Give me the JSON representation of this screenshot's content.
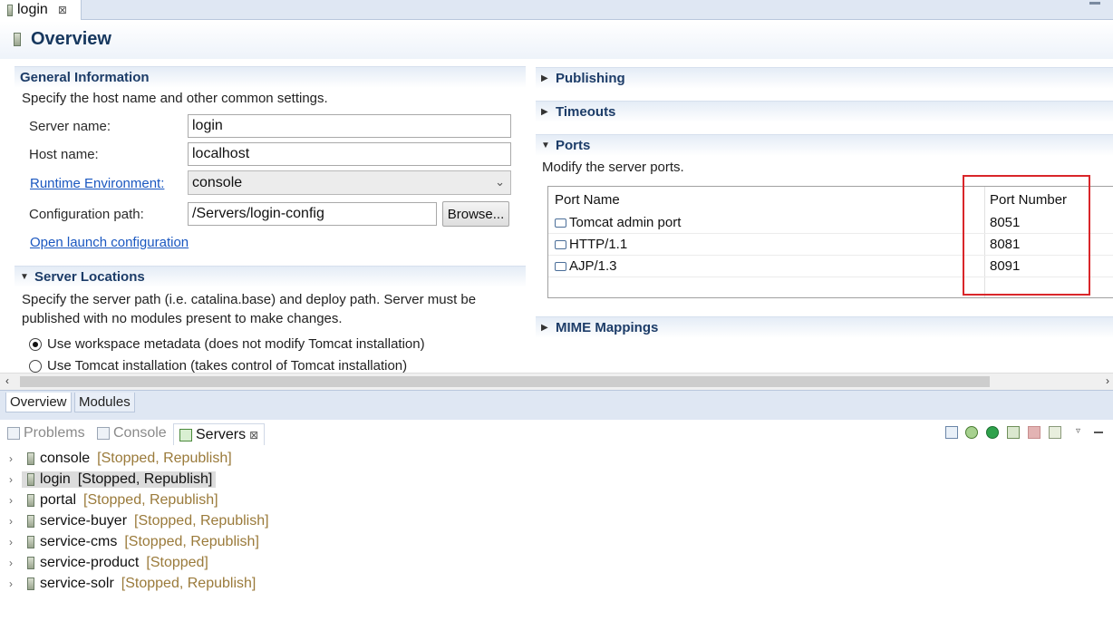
{
  "editor": {
    "tab_label": "login",
    "tab_close": "⊠",
    "title": "Overview"
  },
  "general": {
    "header": "General Information",
    "desc": "Specify the host name and other common settings.",
    "server_name_label": "Server name:",
    "server_name_value": "login",
    "host_name_label": "Host name:",
    "host_name_value": "localhost",
    "runtime_label": "Runtime Environment:",
    "runtime_value": "console",
    "config_label": "Configuration path:",
    "config_value": "/Servers/login-config",
    "browse_label": "Browse...",
    "launch_link": "Open launch configuration"
  },
  "locations": {
    "header": "Server Locations",
    "desc_line1": "Specify the server path (i.e. catalina.base) and deploy path. Server must be",
    "desc_line2": "published with no modules present to make changes.",
    "radio1": "Use workspace metadata (does not modify Tomcat installation)",
    "radio2": "Use Tomcat installation (takes control of Tomcat installation)"
  },
  "right_sections": {
    "publishing": "Publishing",
    "timeouts": "Timeouts",
    "ports": "Ports",
    "ports_desc": "Modify the server ports.",
    "mime": "MIME Mappings"
  },
  "ports_table": {
    "col_name": "Port Name",
    "col_number": "Port Number",
    "rows": [
      {
        "name": "Tomcat admin port",
        "number": "8051"
      },
      {
        "name": "HTTP/1.1",
        "number": "8081"
      },
      {
        "name": "AJP/1.3",
        "number": "8091"
      }
    ]
  },
  "page_tabs": {
    "overview": "Overview",
    "modules": "Modules"
  },
  "views": {
    "problems": "Problems",
    "console": "Console",
    "servers": "Servers",
    "servers_close": "⊠"
  },
  "servers": [
    {
      "name": "console",
      "status": "[Stopped, Republish]"
    },
    {
      "name": "login",
      "status": "[Stopped, Republish]"
    },
    {
      "name": "portal",
      "status": "[Stopped, Republish]"
    },
    {
      "name": "service-buyer",
      "status": "[Stopped, Republish]"
    },
    {
      "name": "service-cms",
      "status": "[Stopped, Republish]"
    },
    {
      "name": "service-product",
      "status": "[Stopped]"
    },
    {
      "name": "service-solr",
      "status": "[Stopped, Republish]"
    }
  ],
  "colors": {
    "accent": "#16375e",
    "link": "#1a57c0",
    "status": "#9a7a3a",
    "highlight": "#d9262a"
  }
}
